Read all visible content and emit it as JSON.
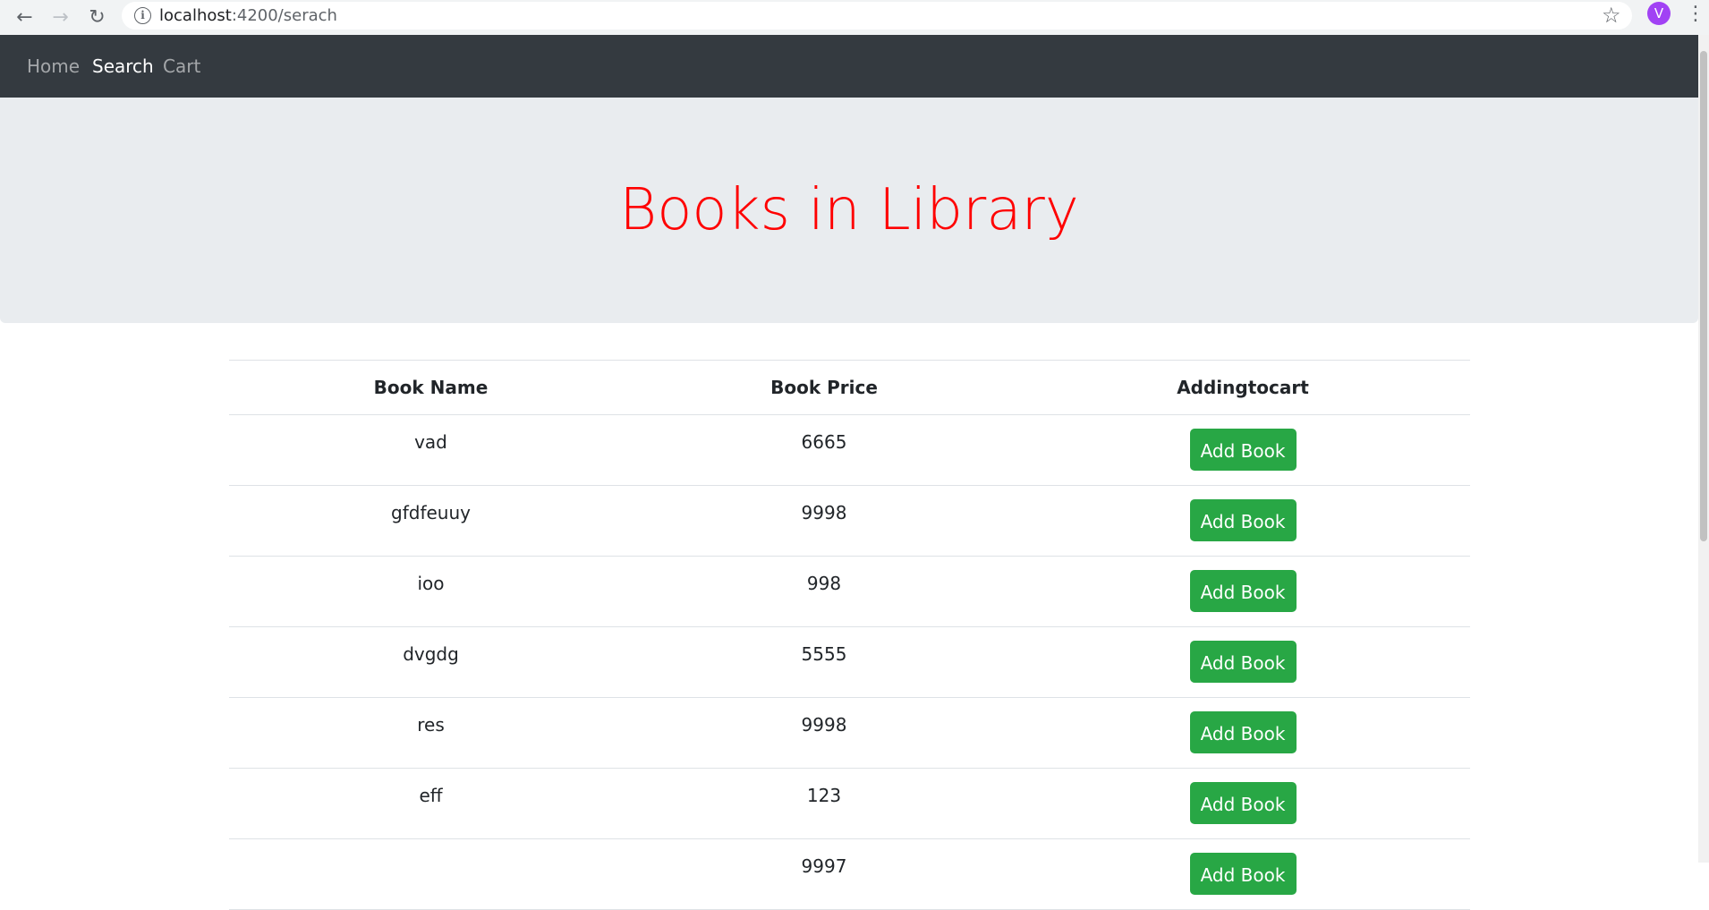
{
  "browser": {
    "url_host": "localhost",
    "url_path": ":4200/serach",
    "avatar_letter": "V",
    "icons": [
      "back-icon",
      "forward-icon",
      "reload-icon",
      "info-icon",
      "star-icon",
      "menu-icon"
    ]
  },
  "navbar": {
    "items": [
      {
        "label": "Home",
        "active": false
      },
      {
        "label": "Search",
        "active": true
      },
      {
        "label": "Cart",
        "active": false
      }
    ]
  },
  "jumbotron": {
    "title": "Books in Library",
    "title_color": "#ff0000"
  },
  "table": {
    "headers": [
      "Book Name",
      "Book Price",
      "Addingtocart"
    ],
    "rows": [
      {
        "name": "vad",
        "price": "6665",
        "action": "Add Book"
      },
      {
        "name": "gfdfeuuy",
        "price": "9998",
        "action": "Add Book"
      },
      {
        "name": "ioo",
        "price": "998",
        "action": "Add Book"
      },
      {
        "name": "dvgdg",
        "price": "5555",
        "action": "Add Book"
      },
      {
        "name": "res",
        "price": "9998",
        "action": "Add Book"
      },
      {
        "name": "eff",
        "price": "123",
        "action": "Add Book"
      },
      {
        "name": "",
        "price": "9997",
        "action": "Add Book"
      }
    ]
  },
  "colors": {
    "navbar_bg": "#343a40",
    "jumbotron_bg": "#e9ecef",
    "button_bg": "#28a745"
  }
}
